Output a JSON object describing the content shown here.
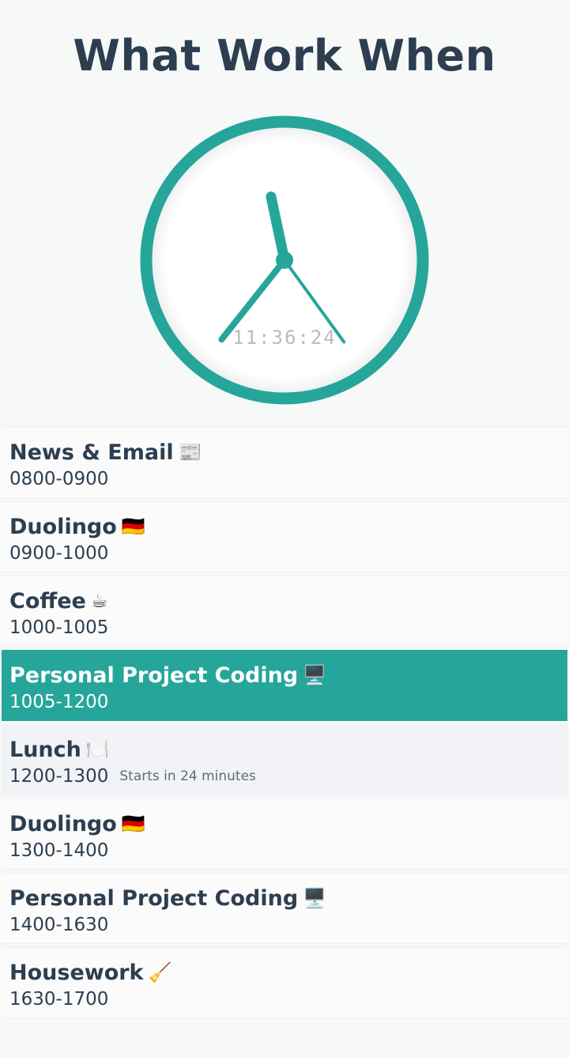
{
  "app": {
    "title": "What Work When"
  },
  "clock": {
    "digital_time": "11:36:24",
    "hour": 11,
    "minute": 36,
    "second": 24,
    "accent_color": "#26a69a"
  },
  "schedule": [
    {
      "title": "News & Email",
      "emoji": "📰",
      "time": "0800-0900",
      "note": "",
      "state": "default"
    },
    {
      "title": "Duolingo",
      "emoji": "🇩🇪",
      "time": "0900-1000",
      "note": "",
      "state": "default"
    },
    {
      "title": "Coffee",
      "emoji": "☕",
      "time": "1000-1005",
      "note": "",
      "state": "default"
    },
    {
      "title": "Personal Project Coding",
      "emoji": "🖥️",
      "time": "1005-1200",
      "note": "",
      "state": "current"
    },
    {
      "title": "Lunch",
      "emoji": "🍽️",
      "time": "1200-1300",
      "note": "Starts in 24 minutes",
      "state": "next"
    },
    {
      "title": "Duolingo",
      "emoji": "🇩🇪",
      "time": "1300-1400",
      "note": "",
      "state": "default"
    },
    {
      "title": "Personal Project Coding",
      "emoji": "🖥️",
      "time": "1400-1630",
      "note": "",
      "state": "default"
    },
    {
      "title": "Housework",
      "emoji": "🧹",
      "time": "1630-1700",
      "note": "",
      "state": "default"
    }
  ],
  "colors": {
    "current_bg": "#26a69a",
    "next_bg": "#f2f3f6",
    "text": "#2c3e50"
  }
}
